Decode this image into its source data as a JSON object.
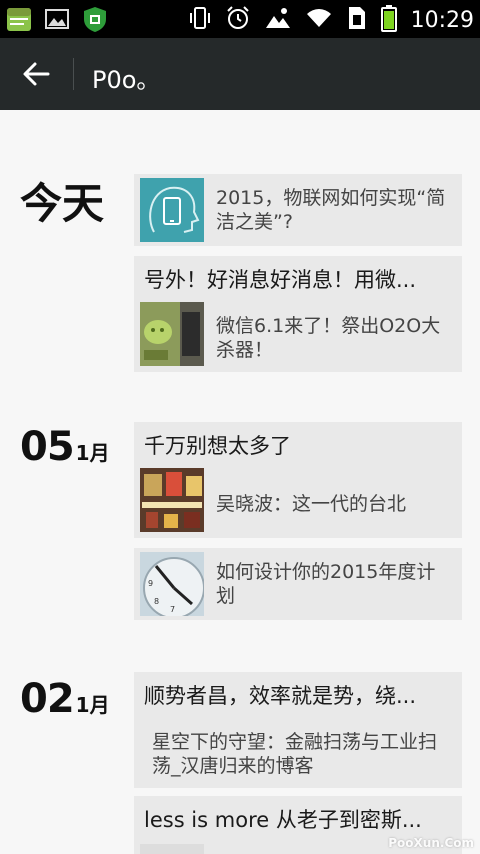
{
  "statusbar": {
    "time": "10:29",
    "left_icons": [
      "notes-app-icon",
      "gallery-icon",
      "security-shield-icon"
    ],
    "right_icons": [
      "vibrate-icon",
      "alarm-icon",
      "photo-sync-icon",
      "wifi-icon",
      "sim-card-icon",
      "battery-icon"
    ]
  },
  "titlebar": {
    "title": "P0o。"
  },
  "groups": [
    {
      "day": "今天",
      "month": "",
      "cards": [
        {
          "headline": "",
          "items": [
            {
              "text": "2015，物联网如何实现“简洁之美”?"
            }
          ]
        },
        {
          "headline": "号外！好消息好消息！用微...",
          "items": [
            {
              "text": "微信6.1来了！祭出O2O大杀器！"
            }
          ]
        }
      ]
    },
    {
      "day": "05",
      "month": "1月",
      "cards": [
        {
          "headline": "千万别想太多了",
          "items": [
            {
              "text": "吴晓波：这一代的台北"
            }
          ]
        },
        {
          "headline": "",
          "items": [
            {
              "text": "如何设计你的2015年度计划"
            }
          ]
        }
      ]
    },
    {
      "day": "02",
      "month": "1月",
      "cards": [
        {
          "headline": "顺势者昌，效率就是势，绕...",
          "items": [
            {
              "text": "星空下的守望：金融扫荡与工业扫荡_汉唐归来的博客"
            }
          ]
        },
        {
          "headline": "less is more 从老子到密斯...",
          "items": []
        }
      ]
    }
  ],
  "watermark": "PooXun.Com"
}
